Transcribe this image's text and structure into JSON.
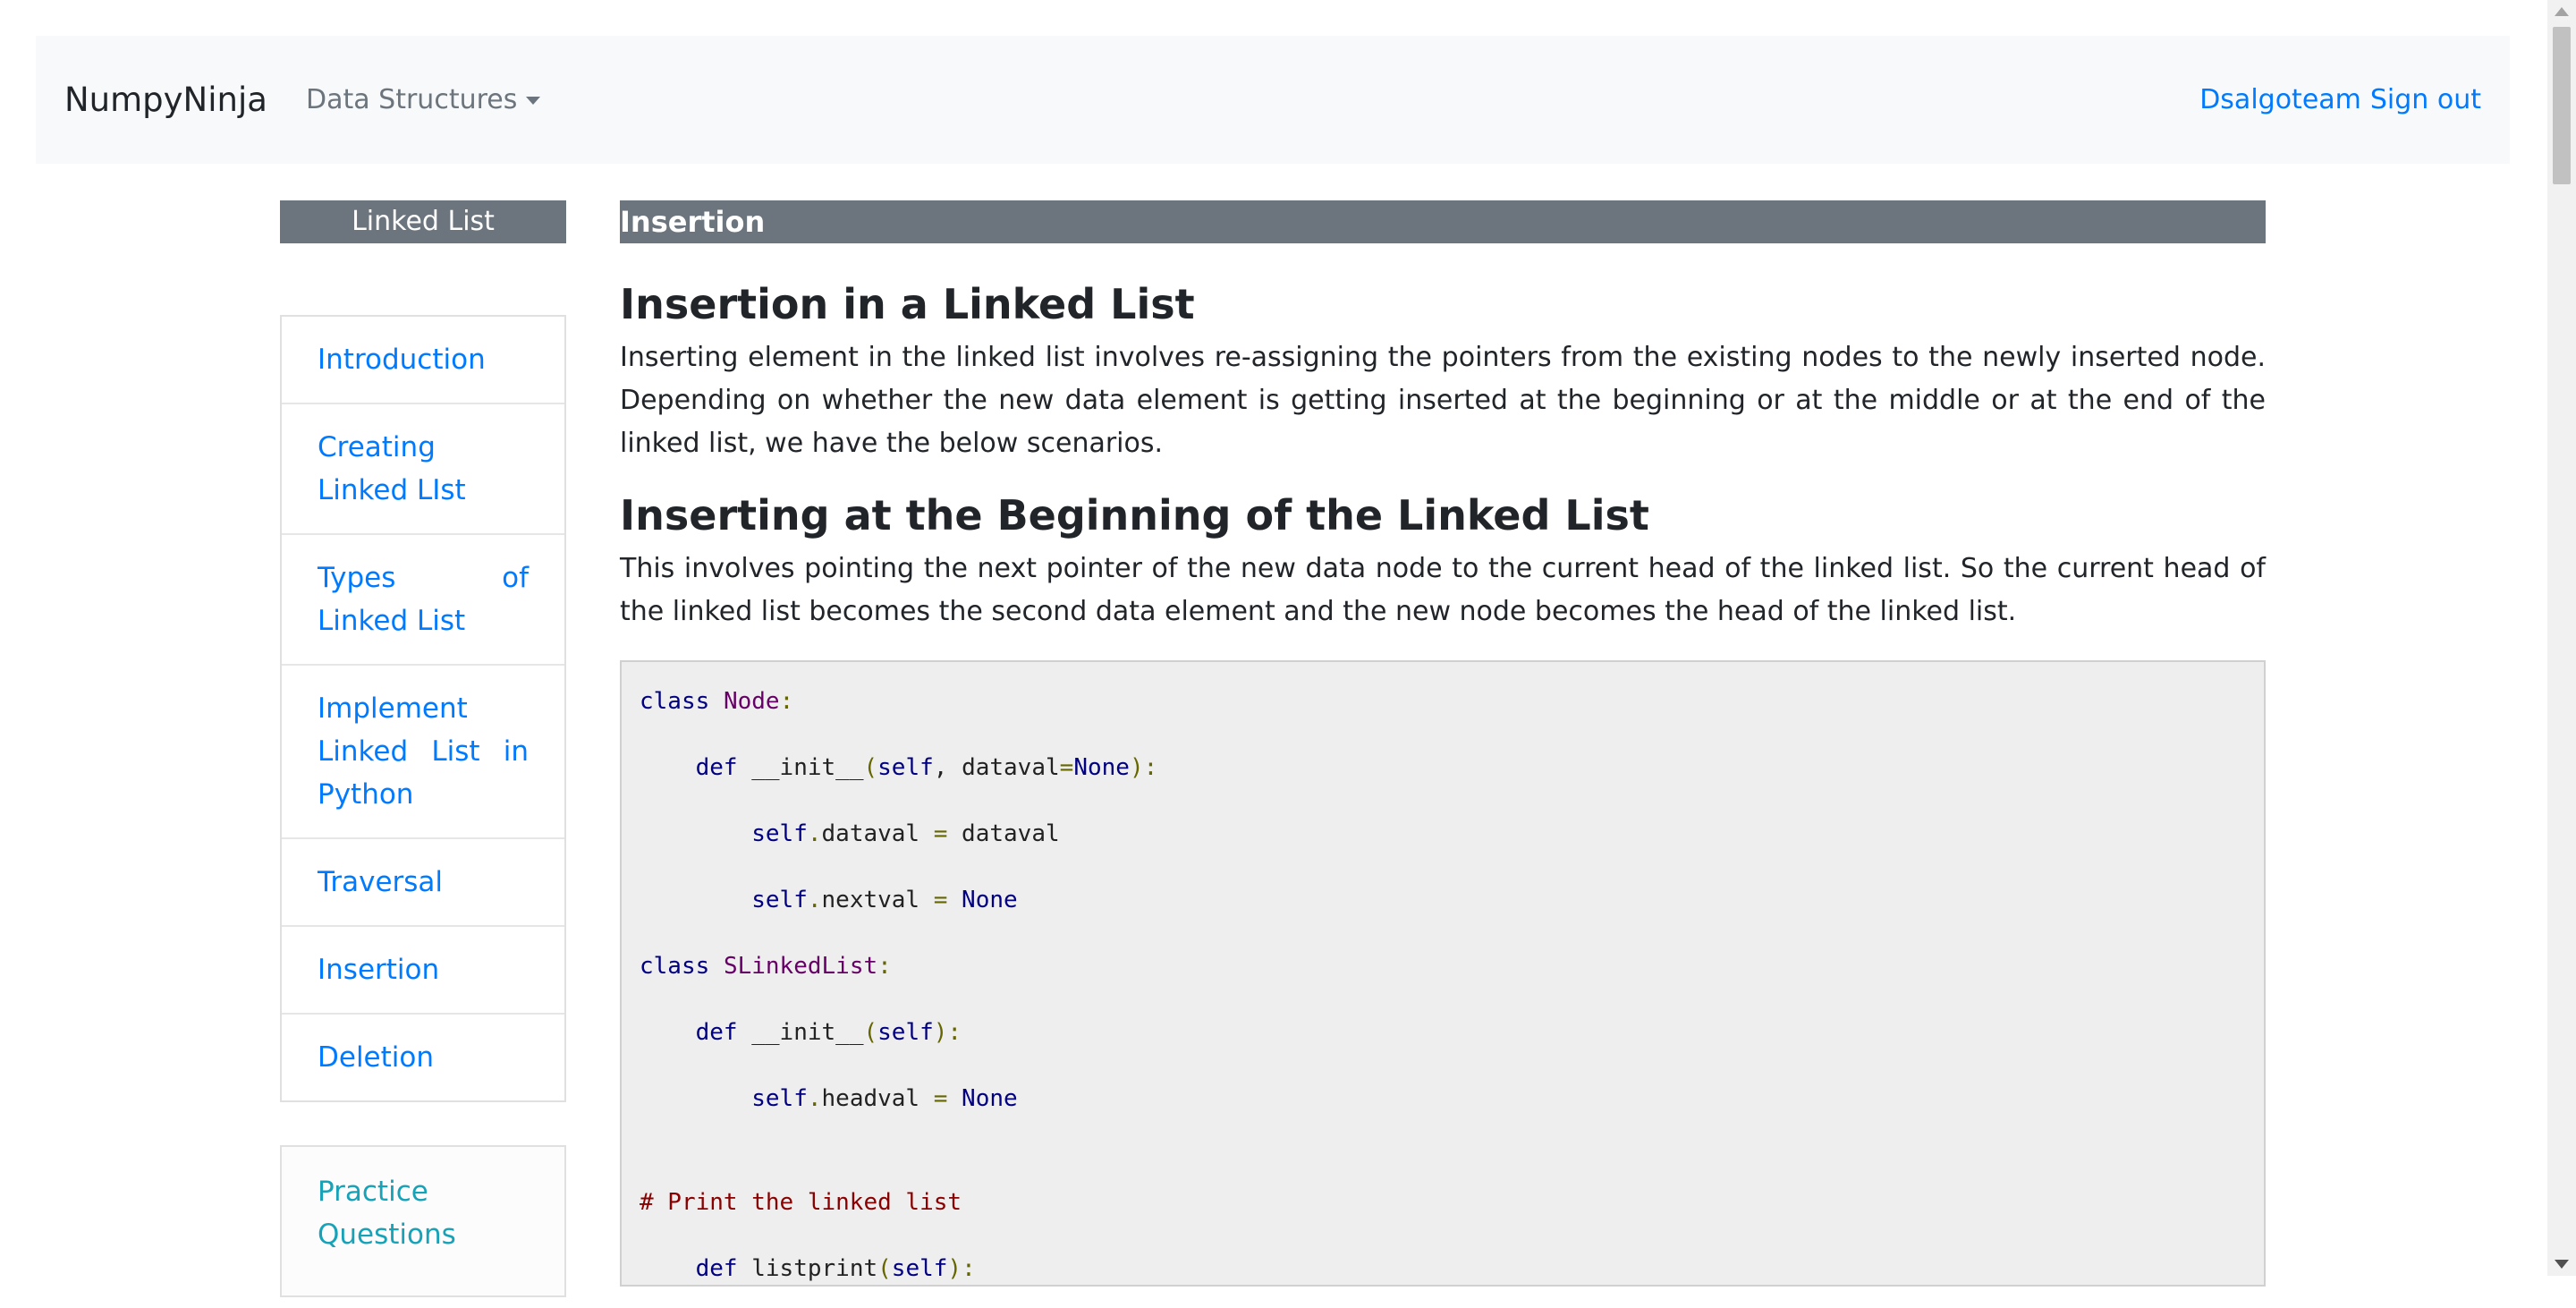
{
  "navbar": {
    "brand": "NumpyNinja",
    "dropdown_label": "Data Structures",
    "user_name": "Dsalgoteam",
    "sign_out": "Sign out"
  },
  "sidebar": {
    "header": "Linked List",
    "items": [
      {
        "label": "Introduction"
      },
      {
        "label": "Creating Linked LIst"
      },
      {
        "label": "Types of Linked List"
      },
      {
        "label": "Implement Linked List in Python"
      },
      {
        "label": "Traversal"
      },
      {
        "label": "Insertion"
      },
      {
        "label": "Deletion"
      }
    ],
    "practice_label": "Practice Questions"
  },
  "main": {
    "topic_bar": "Insertion",
    "heading": "Insertion in a Linked List",
    "intro": "Inserting element in the linked list involves re-assigning the pointers from the existing nodes to the newly inserted node. Depending on whether the new data element is getting inserted at the beginning or at the middle or at the end of the linked list, we have the below scenarios.",
    "subheading": "Inserting at the Beginning of the Linked List",
    "sub_text": "This involves pointing the next pointer of the new data node to the current head of the linked list. So the current head of the linked list becomes the second data element and the new node becomes the head of the linked list.",
    "code": {
      "l1_kw": "class",
      "l1_name": "Node",
      "l1_colon": ":",
      "l2_def": "def",
      "l2_fn": " __init__",
      "l2_p1": "(",
      "l2_self": "self",
      "l2_args": ", dataval",
      "l2_eq": "=",
      "l2_none": "None",
      "l2_p2": "):",
      "l3_self": "self",
      "l3_dot": ".",
      "l3_attr": "dataval ",
      "l3_eq": "=",
      "l3_val": " dataval",
      "l4_self": "self",
      "l4_dot": ".",
      "l4_attr": "nextval ",
      "l4_eq": "=",
      "l4_none": " None",
      "l5_kw": "class",
      "l5_name": "SLinkedList",
      "l5_colon": ":",
      "l6_def": "def",
      "l6_fn": " __init__",
      "l6_p1": "(",
      "l6_self": "self",
      "l6_p2": "):",
      "l7_self": "self",
      "l7_dot": ".",
      "l7_attr": "headval ",
      "l7_eq": "=",
      "l7_none": " None",
      "l8_comment": "# Print the linked list",
      "l9_def": "def",
      "l9_fn": " listprint",
      "l9_p1": "(",
      "l9_self": "self",
      "l9_p2": "):"
    }
  },
  "colors": {
    "navbar_bg": "#f8f9fa",
    "link_blue": "#007bff",
    "practice_teal": "#17a2b8",
    "header_gray": "#6c757d",
    "code_bg": "#eeeeee"
  }
}
